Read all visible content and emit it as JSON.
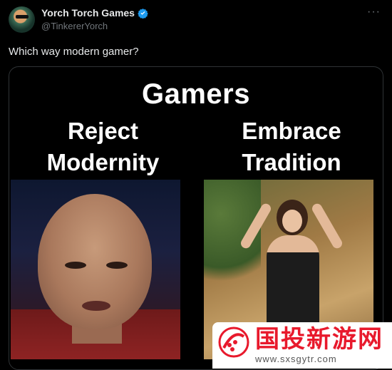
{
  "author": {
    "display_name": "Yorch Torch Games",
    "handle": "@TinkererYorch",
    "verified_icon": "verified-badge-icon"
  },
  "menu_icon": "more-options-icon",
  "tweet": {
    "text": "Which way modern gamer?"
  },
  "meme": {
    "title": "Gamers",
    "left_caption_line1": "Reject",
    "left_caption_line2": "Modernity",
    "right_caption_line1": "Embrace",
    "right_caption_line2": "Tradition"
  },
  "watermark": {
    "text": "国投新游网",
    "url": "www.sxsgytr.com"
  },
  "colors": {
    "background": "#000000",
    "text": "#e7e9ea",
    "muted": "#71767b",
    "verified": "#1d9bf0",
    "watermark_red": "#e8192c"
  }
}
